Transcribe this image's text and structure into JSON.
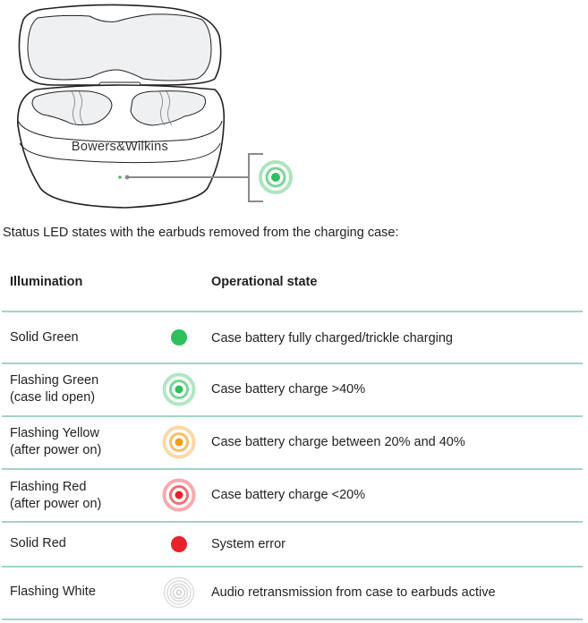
{
  "illustration": {
    "brand_label": "Bowers&Wilkins",
    "callout_led_color": "#2fbf5d"
  },
  "intro_text": "Status LED states with the earbuds removed from the charging case:",
  "table": {
    "headers": {
      "illumination": "Illumination",
      "operational_state": "Operational state"
    },
    "rows": [
      {
        "illumination_line1": "Solid Green",
        "illumination_line2": "",
        "led_type": "solid",
        "led_color": "#2fbf5d",
        "state": "Case battery fully charged/trickle charging"
      },
      {
        "illumination_line1": "Flashing Green",
        "illumination_line2": "(case lid open)",
        "led_type": "flashing",
        "led_color": "#2fbf5d",
        "state": "Case battery charge >40%"
      },
      {
        "illumination_line1": "Flashing Yellow",
        "illumination_line2": "(after power on)",
        "led_type": "flashing",
        "led_color": "#f29c12",
        "state": "Case battery charge between 20% and 40%"
      },
      {
        "illumination_line1": "Flashing Red",
        "illumination_line2": "(after power on)",
        "led_type": "flashing",
        "led_color": "#e8222a",
        "state": "Case battery charge <20%"
      },
      {
        "illumination_line1": "Solid Red",
        "illumination_line2": "",
        "led_type": "solid",
        "led_color": "#e8222a",
        "state": "System error"
      },
      {
        "illumination_line1": "Flashing White",
        "illumination_line2": "",
        "led_type": "flashing-white",
        "led_color": "#cfcfcf",
        "state": "Audio retransmission from case to earbuds active"
      }
    ]
  },
  "colors": {
    "rule": "#a2d5c0",
    "text": "#231f20",
    "line_art": "#231f20",
    "callout_line": "#8a8a8a"
  }
}
